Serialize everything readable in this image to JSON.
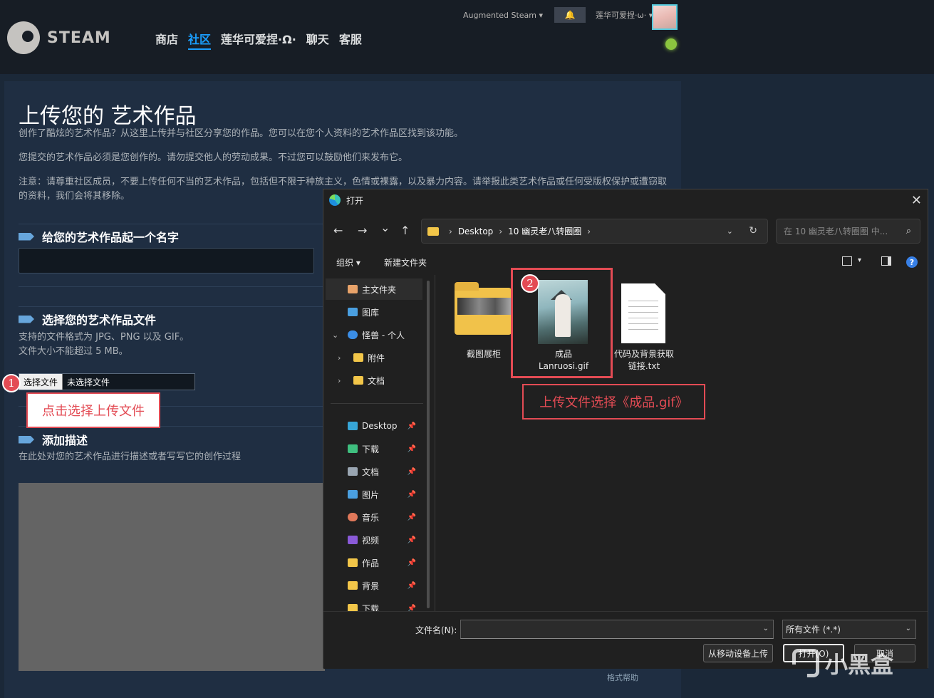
{
  "steam": {
    "logo_text": "STEAM",
    "nav": [
      "商店",
      "社区",
      "莲华可爱捏·Ω·",
      "聊天",
      "客服"
    ],
    "augmented": "Augmented Steam ▾",
    "bell": "🔔",
    "user": "莲华可爱捏·ω· ▾"
  },
  "page": {
    "title": "上传您的 艺术作品",
    "intro": "创作了酷炫的艺术作品？从这里上传并与社区分享您的作品。您可以在您个人资料的艺术作品区找到该功能。",
    "own_work": "您提交的艺术作品必须是您创作的。请勿提交他人的劳动成果。不过您可以鼓励他们来发布它。",
    "notice": "注意：请尊重社区成员，不要上传任何不当的艺术作品，包括但不限于种族主义，色情或裸露，以及暴力内容。请举报此类艺术作品或任何受版权保护或遭窃取的资料，我们会将其移除。",
    "name_heading": "给您的艺术作品起一个名字",
    "file_heading": "选择您的艺术作品文件",
    "file_hint1": "支持的文件格式为 JPG、PNG 以及 GIF。",
    "file_hint2": "文件大小不能超过 5 MB。",
    "choose_file": "选择文件",
    "no_file": "未选择文件",
    "desc_heading": "添加描述",
    "desc_hint": "在此处对您的艺术作品进行描述或者写写它的创作过程",
    "format_help": "格式帮助"
  },
  "annotations": {
    "n1": "1",
    "label1": "点击选择上传文件",
    "n2": "2",
    "label2": "上传文件选择《成品.gif》"
  },
  "dialog": {
    "title": "打开",
    "close": "✕",
    "back": "←",
    "forward": "→",
    "down": "⌄",
    "up": "↑",
    "path_sep": "›",
    "path1": "Desktop",
    "path2": "10 幽灵老八转圈圈",
    "search_placeholder": "在 10 幽灵老八转圈圈 中...",
    "organize": "组织 ▾",
    "new_folder": "新建文件夹",
    "help": "?",
    "sidebar": [
      {
        "label": "主文件夹"
      },
      {
        "label": "图库"
      },
      {
        "label": "怪兽 - 个人"
      },
      {
        "label": "附件"
      },
      {
        "label": "文档"
      },
      {
        "label": "Desktop"
      },
      {
        "label": "下载"
      },
      {
        "label": "文档"
      },
      {
        "label": "图片"
      },
      {
        "label": "音乐"
      },
      {
        "label": "视频"
      },
      {
        "label": "作品"
      },
      {
        "label": "背景"
      },
      {
        "label": "下载"
      }
    ],
    "files": [
      {
        "name": "截图展柜"
      },
      {
        "name": "成品\nLanruosi.gif"
      },
      {
        "name": "代码及背景获取\n链接.txt"
      }
    ],
    "filename_label": "文件名(N):",
    "filetype": "所有文件 (*.*)",
    "from_mobile": "从移动设备上传",
    "open": "打开(O)",
    "cancel": "取消"
  },
  "watermark": "小黑盒"
}
